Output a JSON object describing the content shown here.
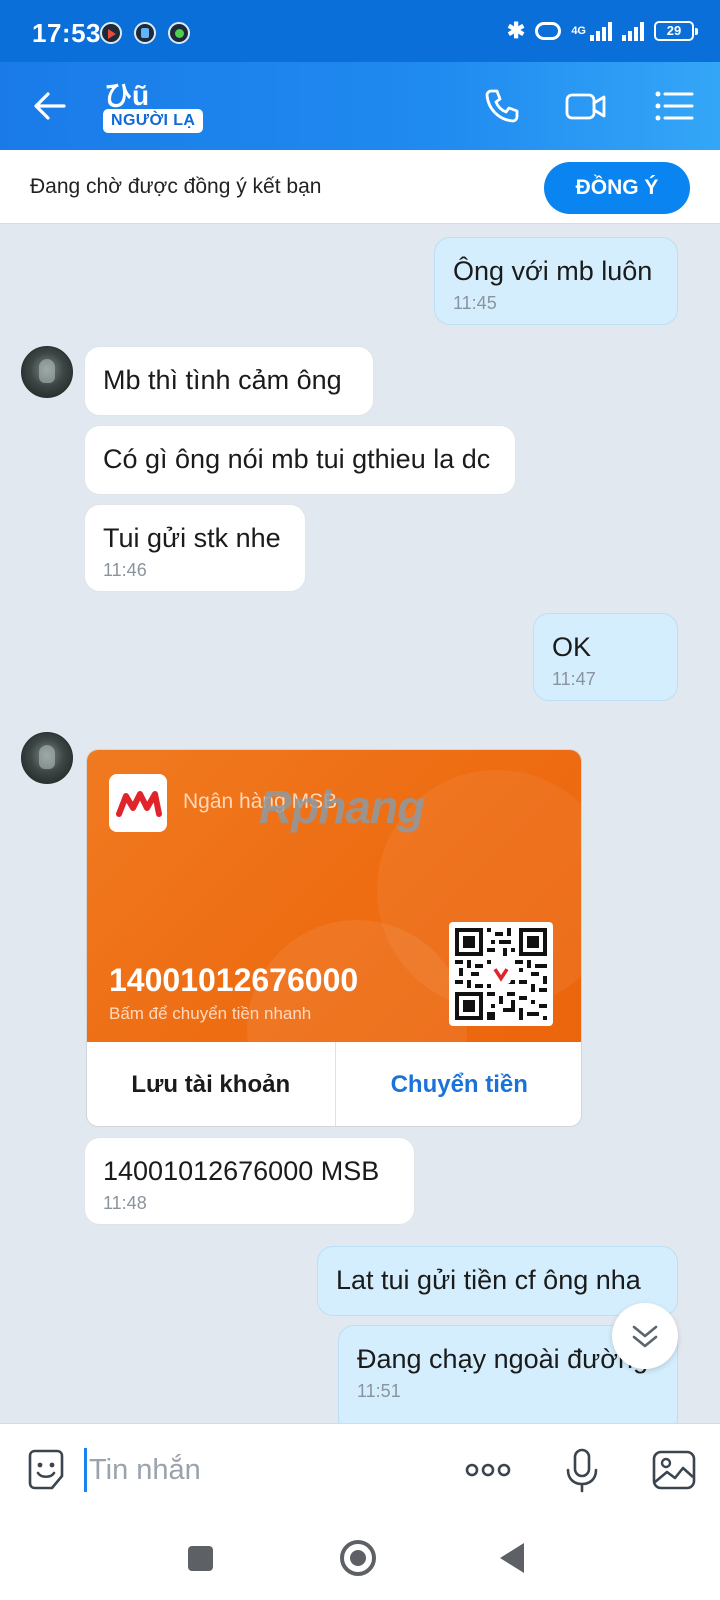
{
  "status_bar": {
    "time": "17:53",
    "network": "4G",
    "battery": "29",
    "bluetooth_glyph": "✱"
  },
  "header": {
    "contact_name": "ひũ",
    "badge": "NGƯỜI LẠ"
  },
  "friend_request": {
    "text": "Đang chờ được đồng ý kết bạn",
    "button": "ĐỒNG Ý"
  },
  "messages": [
    {
      "side": "out",
      "text": "Ông với mb luôn",
      "time": "11:45"
    },
    {
      "side": "in",
      "text": "Mb thì tình cảm ông",
      "time": ""
    },
    {
      "side": "in",
      "text": "Có gì ông nói mb tui gthieu la dc",
      "time": ""
    },
    {
      "side": "in",
      "text": "Tui gửi stk nhe",
      "time": "11:46"
    },
    {
      "side": "out",
      "text": "OK",
      "time": "11:47"
    },
    {
      "side": "in",
      "text": "14001012676000 MSB",
      "time": "11:48"
    },
    {
      "side": "out",
      "text": "Lat tui gửi tiền cf ông nha",
      "time": ""
    },
    {
      "side": "out",
      "text": "Đang chạy ngoài đường",
      "time": "11:51"
    }
  ],
  "bank_card": {
    "bank_name": "Ngân hàng MSB",
    "account_number": "14001012676000",
    "hint": "Bấm để chuyển tiền nhanh",
    "save_button": "Lưu tài khoản",
    "transfer_button": "Chuyển tiền",
    "watermark": "Rphang",
    "brand_color": "#ee6c12"
  },
  "composer": {
    "placeholder": "Tin nhắn"
  },
  "colors": {
    "header": "#1f8af0",
    "accent": "#0a84f0",
    "outgoing_bubble": "#d4eefd",
    "chat_bg": "#e2e8ef"
  }
}
